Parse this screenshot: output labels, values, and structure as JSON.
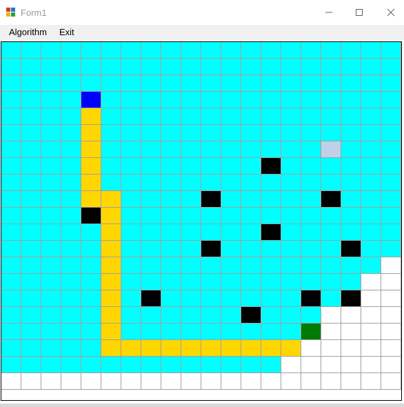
{
  "window": {
    "title": "Form1",
    "icon": "app-icon",
    "controls": [
      "minimize-icon",
      "maximize-icon",
      "close-icon"
    ]
  },
  "menu": {
    "items": [
      {
        "label": "Algorithm"
      },
      {
        "label": "Exit"
      }
    ]
  },
  "grid": {
    "rows": 21,
    "cols": 20,
    "colors": {
      "C": "#00ffff",
      "W": "#ffffff",
      "K": "#000000",
      "Y": "#ffd700",
      "B": "#0000ff",
      "G": "#007a00",
      "L": "#c0d0e8"
    },
    "legend": {
      "C": "visited",
      "W": "unvisited",
      "K": "obstacle",
      "Y": "path",
      "B": "start",
      "G": "goal",
      "L": "selected"
    },
    "cells": [
      "CCCCCCCCCCCCCCCCCCCC",
      "CCCCCCCCCCCCCCCCCCCC",
      "CCCCCCCCCCCCCCCCCCCC",
      "CCCCBCCCCCCCCCCCCCCC",
      "CCCCYCCCCCCCCCCCCCCC",
      "CCCCYCCCCCCCCCCCCCCC",
      "CCCCYCCCCCCCCCCCLCCC",
      "CCCCYCCCCCCCCKCCCCCC",
      "CCCCYCCCCCCCCCCCCCCC",
      "CCCCYYCCCCKCCCCCKCCC",
      "CCCCKYCCCCCCCCCCCCCC",
      "CCCCCYCCCCCCCKCCCCCC",
      "CCCCCYCCCCKCCCCCCKCC",
      "CCCCCYCCCCCCCCCCCCCW",
      "CCCCCYCCCCCCCCCCCCWW",
      "CCCCCYCKCCCCCCCKCKWW",
      "CCCCCYCCCCCCKCCCWWWW",
      "CCCCCYCCCCCCCCCGWWWW",
      "CCCCCYYYYYYYYYYWWWWW",
      "CCCCCCCCCCCCCCWWWWWW",
      "WWWWWWWWWWWWWWWWWWWW"
    ]
  }
}
